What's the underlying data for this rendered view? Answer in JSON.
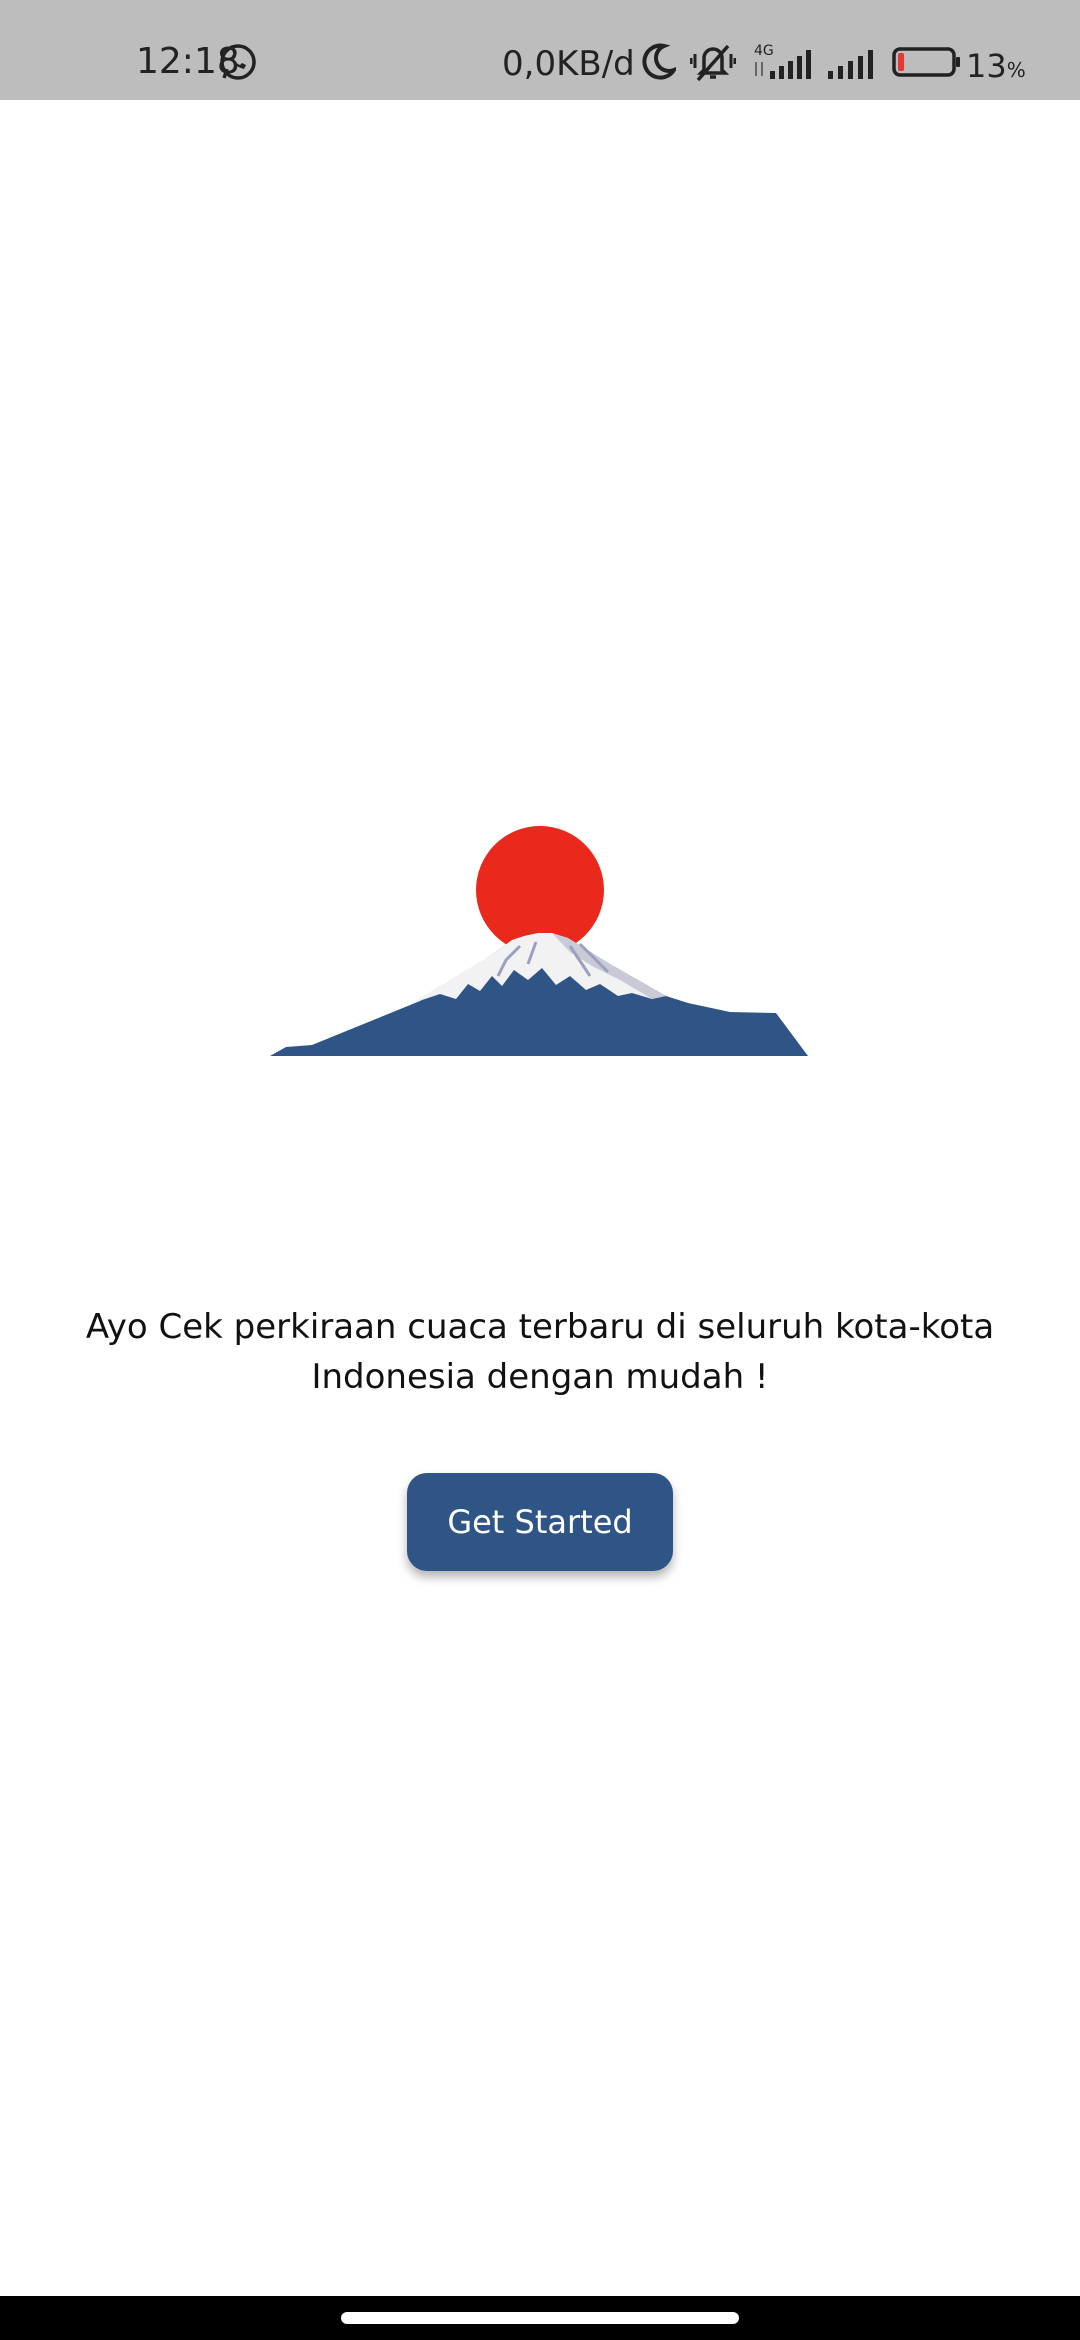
{
  "status_bar": {
    "time": "12:18",
    "network_speed": "0,0KB/d",
    "network_type": "4G",
    "battery_percent": "13",
    "battery_unit": "%",
    "battery_level": 0.13,
    "battery_color": "#e53935",
    "icons": [
      "whatsapp-icon",
      "moon-icon",
      "vibrate-silent-icon",
      "signal-4g-icon",
      "signal-icon",
      "battery-icon"
    ]
  },
  "hero": {
    "illustration": "mountain-sunrise",
    "sun_color": "#e8291c",
    "mountain_color": "#2f5586",
    "snow_color": "#f2f2f2"
  },
  "main": {
    "tagline": "Ayo Cek perkiraan cuaca terbaru di seluruh kota-kota Indonesia dengan mudah !",
    "cta_label": "Get Started",
    "cta_color": "#2f5586"
  }
}
